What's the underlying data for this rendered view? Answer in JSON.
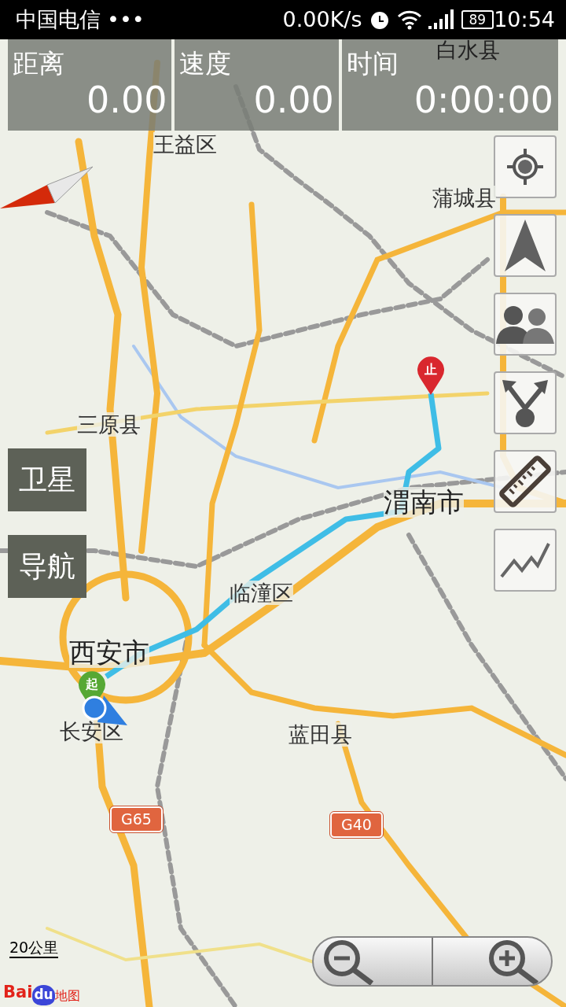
{
  "status_bar": {
    "carrier": "中国电信",
    "dots": "•••",
    "speed": "0.00K/s",
    "battery": "89",
    "time": "10:54"
  },
  "stats": [
    {
      "label": "距离",
      "value": "0.00"
    },
    {
      "label": "速度",
      "value": "0.00"
    },
    {
      "label": "时间",
      "value": "0:00:00"
    }
  ],
  "map_labels": [
    "白水县",
    "王益区",
    "蒲城县",
    "三原县",
    "渭南市",
    "临潼区",
    "西安市",
    "长安区",
    "蓝田县"
  ],
  "road_shields": [
    "G65",
    "G40"
  ],
  "route_markers": {
    "start": "起",
    "end": "止"
  },
  "layer_buttons": [
    "卫星",
    "导航"
  ],
  "scale": "20公里",
  "logo": {
    "part_1": "Bai",
    "part_2": "du",
    "part_3": "地图"
  }
}
